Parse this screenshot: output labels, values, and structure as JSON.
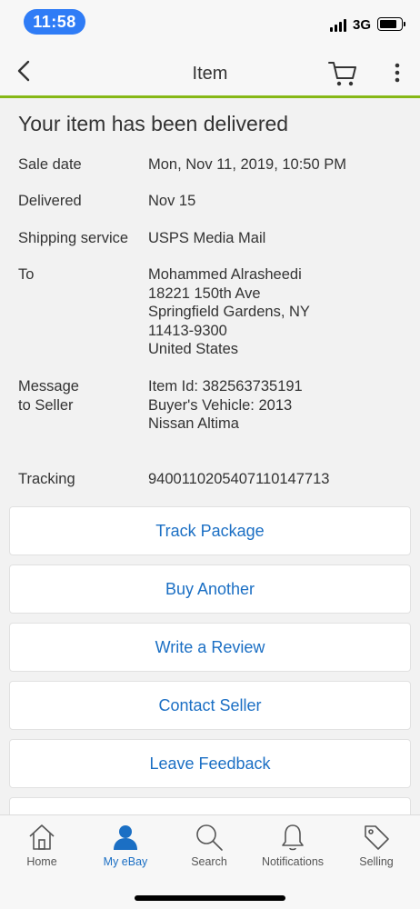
{
  "status_bar": {
    "time": "11:58",
    "network": "3G"
  },
  "nav": {
    "title": "Item",
    "back_icon": "chevron-left-icon",
    "cart_icon": "cart-icon",
    "more_icon": "more-vertical-icon"
  },
  "order": {
    "headline": "Your item has been delivered",
    "sale_date_label": "Sale date",
    "sale_date": "Mon, Nov 11, 2019, 10:50 PM",
    "delivered_label": "Delivered",
    "delivered": "Nov 15",
    "shipping_label": "Shipping service",
    "shipping": "USPS Media Mail",
    "to_label": "To",
    "to_lines": [
      "Mohammed Alrasheedi",
      "18221 150th Ave",
      "Springfield Gardens, NY",
      "11413-9300",
      "United States"
    ],
    "message_label_lines": [
      "Message",
      "to Seller"
    ],
    "message_lines": [
      "Item Id: 382563735191",
      "Buyer's Vehicle: 2013",
      "Nissan Altima"
    ],
    "tracking_label": "Tracking",
    "tracking": "9400110205407110147713"
  },
  "actions": [
    {
      "label": "Track Package"
    },
    {
      "label": "Buy Another"
    },
    {
      "label": "Write a Review"
    },
    {
      "label": "Contact Seller"
    },
    {
      "label": "Leave Feedback"
    }
  ],
  "tabs": [
    {
      "label": "Home",
      "icon": "home-icon",
      "active": false
    },
    {
      "label": "My eBay",
      "icon": "person-icon",
      "active": true
    },
    {
      "label": "Search",
      "icon": "search-icon",
      "active": false
    },
    {
      "label": "Notifications",
      "icon": "bell-icon",
      "active": false
    },
    {
      "label": "Selling",
      "icon": "tag-icon",
      "active": false
    }
  ],
  "colors": {
    "accent": "#1b6fc4",
    "nav_underline": "#86b817",
    "time_pill": "#2f7cf6"
  }
}
